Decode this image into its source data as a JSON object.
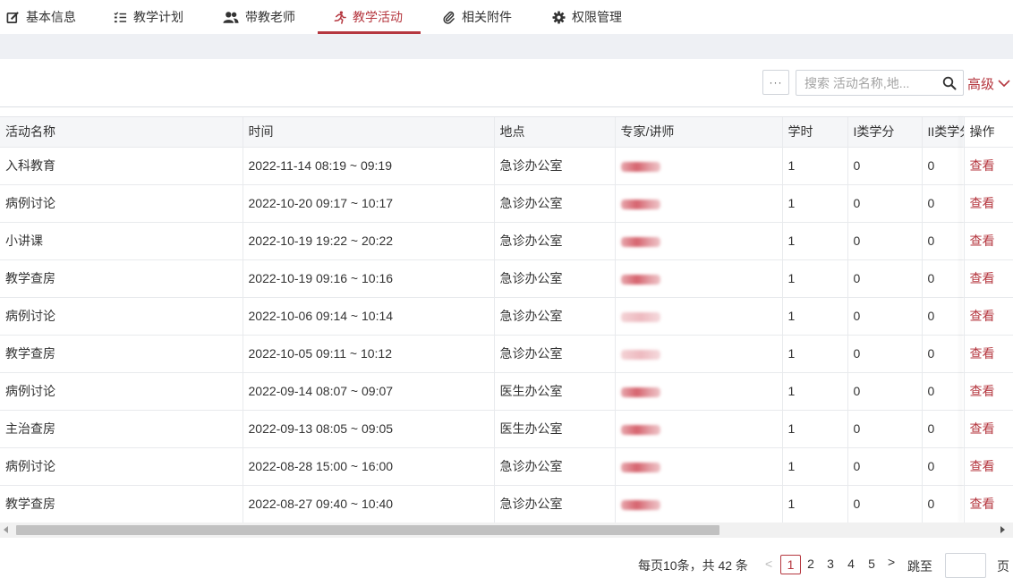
{
  "tabs": [
    {
      "label": "基本信息",
      "icon": "edit-icon"
    },
    {
      "label": "教学计划",
      "icon": "list-icon"
    },
    {
      "label": "带教老师",
      "icon": "users-icon"
    },
    {
      "label": "教学活动",
      "icon": "running-icon",
      "active": true
    },
    {
      "label": "相关附件",
      "icon": "paperclip-icon"
    },
    {
      "label": "权限管理",
      "icon": "gear-icon"
    }
  ],
  "toolbar": {
    "more_label": "···",
    "search_placeholder": "搜索 活动名称,地...",
    "advanced_label": "高级"
  },
  "table": {
    "columns": [
      "活动名称",
      "时间",
      "地点",
      "专家/讲师",
      "学时",
      "I类学分",
      "II类学分",
      "操作"
    ],
    "rows": [
      {
        "name": "入科教育",
        "time": "2022-11-14 08:19 ~ 09:19",
        "place": "急诊办公室",
        "hours": "1",
        "credit1": "0",
        "credit2": "0",
        "action": "查看"
      },
      {
        "name": "病例讨论",
        "time": "2022-10-20 09:17 ~ 10:17",
        "place": "急诊办公室",
        "hours": "1",
        "credit1": "0",
        "credit2": "0",
        "action": "查看"
      },
      {
        "name": "小讲课",
        "time": "2022-10-19 19:22 ~ 20:22",
        "place": "急诊办公室",
        "hours": "1",
        "credit1": "0",
        "credit2": "0",
        "action": "查看"
      },
      {
        "name": "教学查房",
        "time": "2022-10-19 09:16 ~ 10:16",
        "place": "急诊办公室",
        "hours": "1",
        "credit1": "0",
        "credit2": "0",
        "action": "查看"
      },
      {
        "name": "病例讨论",
        "time": "2022-10-06 09:14 ~ 10:14",
        "place": "急诊办公室",
        "hours": "1",
        "credit1": "0",
        "credit2": "0",
        "action": "查看"
      },
      {
        "name": "教学查房",
        "time": "2022-10-05 09:11 ~ 10:12",
        "place": "急诊办公室",
        "hours": "1",
        "credit1": "0",
        "credit2": "0",
        "action": "查看"
      },
      {
        "name": "病例讨论",
        "time": "2022-09-14 08:07 ~ 09:07",
        "place": "医生办公室",
        "hours": "1",
        "credit1": "0",
        "credit2": "0",
        "action": "查看"
      },
      {
        "name": "主治查房",
        "time": "2022-09-13 08:05 ~ 09:05",
        "place": "医生办公室",
        "hours": "1",
        "credit1": "0",
        "credit2": "0",
        "action": "查看"
      },
      {
        "name": "病例讨论",
        "time": "2022-08-28 15:00 ~ 16:00",
        "place": "急诊办公室",
        "hours": "1",
        "credit1": "0",
        "credit2": "0",
        "action": "查看"
      },
      {
        "name": "教学查房",
        "time": "2022-08-27 09:40 ~ 10:40",
        "place": "急诊办公室",
        "hours": "1",
        "credit1": "0",
        "credit2": "0",
        "action": "查看"
      }
    ]
  },
  "pagination": {
    "summary": "每页10条，共 42 条",
    "prev": "<",
    "pages": [
      "1",
      "2",
      "3",
      "4",
      "5"
    ],
    "current": "1",
    "next": ">",
    "jump_label": "跳至",
    "page_unit": "页"
  },
  "colors": {
    "accent": "#b5373f",
    "band": "#eef0f4",
    "header_bg": "#f5f6f8"
  }
}
